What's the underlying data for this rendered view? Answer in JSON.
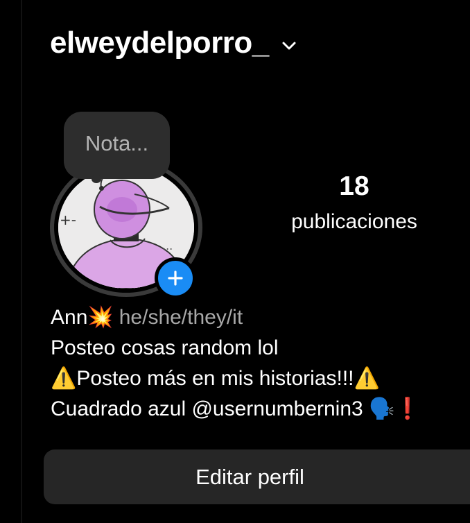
{
  "header": {
    "username": "elweydelporro_",
    "switch_icon": "chevron-down-icon"
  },
  "note": {
    "placeholder": "Nota..."
  },
  "profile": {
    "avatar_icon": "avatar",
    "add_story_icon": "plus-icon"
  },
  "stats": {
    "posts_count": "18",
    "posts_label": "publicaciones"
  },
  "bio": {
    "name": "Ann💥",
    "pronouns": "he/she/they/it",
    "line1": "Posteo cosas random lol",
    "line2": "⚠️Posteo más en mis historias!!!⚠️",
    "line3": "Cuadrado azul @usernumbernin3  🗣️❗"
  },
  "actions": {
    "edit_profile": "Editar perfil"
  },
  "colors": {
    "background": "#000000",
    "accent_blue": "#1a8cf5",
    "button_bg": "#262626",
    "note_bg": "#2d2d2d",
    "secondary_text": "#a8a8a8"
  }
}
